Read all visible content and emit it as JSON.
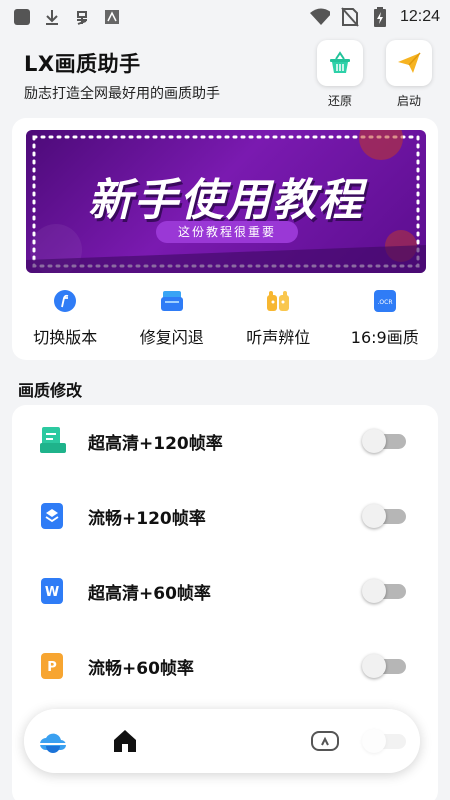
{
  "status_bar": {
    "time": "12:24",
    "left_icons": [
      "app-square-icon",
      "download-icon",
      "bug-icon",
      "image-icon"
    ],
    "right_icons": [
      "wifi-icon",
      "no-sim-icon",
      "battery-charging-icon"
    ]
  },
  "header": {
    "title": "LX画质助手",
    "subtitle": "励志打造全网最好用的画质助手",
    "restore_label": "还原",
    "launch_label": "启动"
  },
  "banner": {
    "headline": "新手使用教程",
    "pill": "这份教程很重要"
  },
  "quick_actions": [
    {
      "label": "切换版本",
      "icon": "pen-circle-icon"
    },
    {
      "label": "修复闪退",
      "icon": "stack-icon"
    },
    {
      "label": "听声辨位",
      "icon": "hands-icon"
    },
    {
      "label": "16:9画质",
      "icon": "ocr-icon"
    }
  ],
  "section": {
    "title": "画质修改"
  },
  "settings": [
    {
      "label": "超高清+120帧率",
      "on": false,
      "icon": "green-doc-icon"
    },
    {
      "label": "流畅+120帧率",
      "on": false,
      "icon": "blue-layers-icon"
    },
    {
      "label": "超高清+60帧率",
      "on": false,
      "icon": "word-doc-icon"
    },
    {
      "label": "流畅+60帧率",
      "on": false,
      "icon": "ppt-doc-icon"
    },
    {
      "label": "",
      "on": false,
      "icon": ""
    }
  ],
  "bottom_nav": {
    "items": [
      "cloud-icon",
      "home-icon",
      "gamepad-icon"
    ],
    "active": "home-icon"
  },
  "colors": {
    "accent_blue": "#2f7cf6",
    "banner_purple": "#6a14a0",
    "toggle_off": "#b6b6b6"
  }
}
